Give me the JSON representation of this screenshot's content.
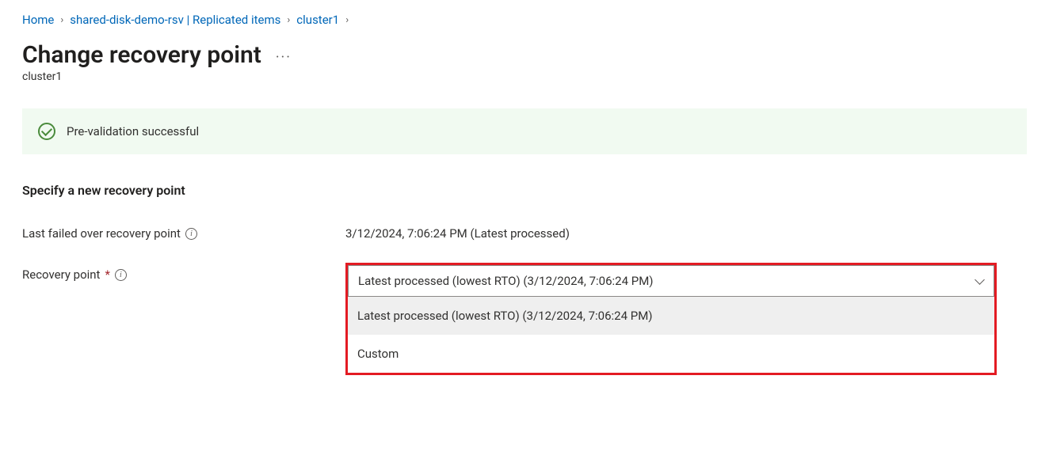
{
  "breadcrumb": {
    "home": "Home",
    "vault": "shared-disk-demo-rsv | Replicated items",
    "cluster": "cluster1"
  },
  "page": {
    "title": "Change recovery point",
    "subtitle": "cluster1"
  },
  "status": {
    "message": "Pre-validation successful"
  },
  "section": {
    "heading": "Specify a new recovery point"
  },
  "lastFailedOver": {
    "label": "Last failed over recovery point",
    "value": "3/12/2024, 7:06:24 PM (Latest processed)"
  },
  "recoveryPoint": {
    "label": "Recovery point",
    "required": "*",
    "selected": "Latest processed (lowest RTO) (3/12/2024, 7:06:24 PM)",
    "options": [
      "Latest processed (lowest RTO) (3/12/2024, 7:06:24 PM)",
      "Custom"
    ]
  }
}
